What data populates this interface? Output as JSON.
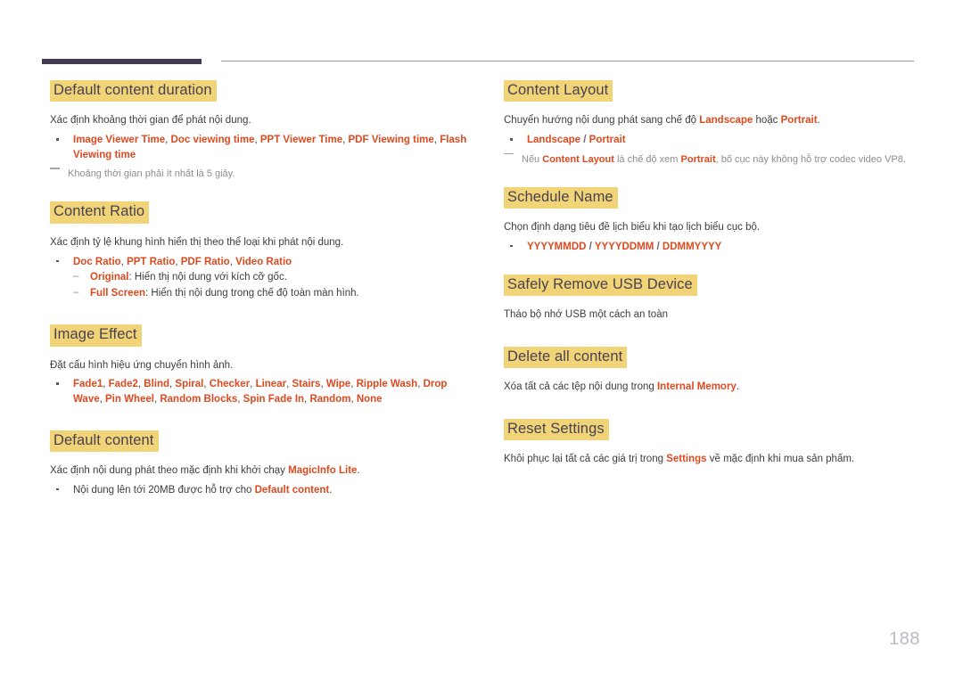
{
  "page": {
    "number": "188",
    "accent_bar_color": "#443a52",
    "highlight_color": "#f0d477",
    "keyword_color": "#dd4a20",
    "heading_text_color": "#4a4152",
    "note_color": "#8d8d8d"
  },
  "left_column": {
    "s1": {
      "heading": "Default content duration",
      "para": "Xác định khoảng thời gian để phát nội dung.",
      "bullet": {
        "k1": "Image Viewer Time",
        "c1": ", ",
        "k2": "Doc viewing time",
        "c2": ", ",
        "k3": "PPT Viewer Time",
        "c3": ", ",
        "k4": "PDF Viewing time",
        "c4": ", ",
        "k5": "Flash Viewing time"
      },
      "note": "Khoảng thời gian phải ít nhất là 5 giây."
    },
    "s2": {
      "heading": "Content Ratio",
      "para": "Xác định tỷ lệ khung hình hiển thị theo thể loại khi phát nội dung.",
      "bullet": {
        "k1": "Doc Ratio",
        "c1": ", ",
        "k2": "PPT Ratio",
        "c2": ", ",
        "k3": "PDF Ratio",
        "c3": ", ",
        "k4": "Video Ratio"
      },
      "sub": [
        {
          "key": "Original",
          "text": ": Hiển thị nội dung với kích cỡ gốc."
        },
        {
          "key": "Full Screen",
          "text": ": Hiển thị nội dung trong chế độ toàn màn hình."
        }
      ]
    },
    "s3": {
      "heading": "Image Effect",
      "para": "Đặt cấu hình hiệu ứng chuyển hình ảnh.",
      "effects": [
        "Fade1",
        "Fade2",
        "Blind",
        "Spiral",
        "Checker",
        "Linear",
        "Stairs",
        "Wipe",
        "Ripple Wash",
        "Drop Wave",
        "Pin Wheel",
        "Random Blocks",
        "Spin Fade In",
        "Random",
        "None"
      ]
    },
    "s4": {
      "heading": "Default content",
      "para_pre": "Xác định nội dung phát theo mặc định khi khởi chạy ",
      "para_kw": "MagicInfo Lite",
      "para_post": ".",
      "bullet_pre": "Nội dung lên tới 20MB được hỗ trợ cho ",
      "bullet_kw": "Default content",
      "bullet_post": "."
    }
  },
  "right_column": {
    "s1": {
      "heading": "Content Layout",
      "para_pre": "Chuyển hướng nội dung phát sang chế độ ",
      "para_kw1": "Landscape",
      "para_mid": " hoặc ",
      "para_kw2": "Portrait",
      "para_post": ".",
      "bullet_kw1": "Landscape",
      "bullet_sep": " / ",
      "bullet_kw2": "Portrait",
      "note_pre": "Nếu ",
      "note_kw1": "Content Layout",
      "note_mid": " là chế độ xem ",
      "note_kw2": "Portrait",
      "note_post": ", bố cục này không hỗ trợ codec video VP8."
    },
    "s2": {
      "heading": "Schedule Name",
      "para": "Chọn định dạng tiêu đề lịch biểu khi tạo lịch biểu cục bộ.",
      "formats": [
        "YYYYMMDD",
        "YYYYDDMM",
        "DDMMYYYY"
      ],
      "format_sep": " / "
    },
    "s3": {
      "heading": "Safely Remove USB Device",
      "para": "Tháo bộ nhớ USB một cách an toàn"
    },
    "s4": {
      "heading": "Delete all content",
      "para_pre": "Xóa tất cả các tệp nội dung trong ",
      "para_kw": "Internal Memory",
      "para_post": "."
    },
    "s5": {
      "heading": "Reset Settings",
      "para_pre": "Khôi phục lại tất cả các giá trị trong ",
      "para_kw": "Settings",
      "para_post": " về mặc định khi mua sản phẩm."
    }
  }
}
